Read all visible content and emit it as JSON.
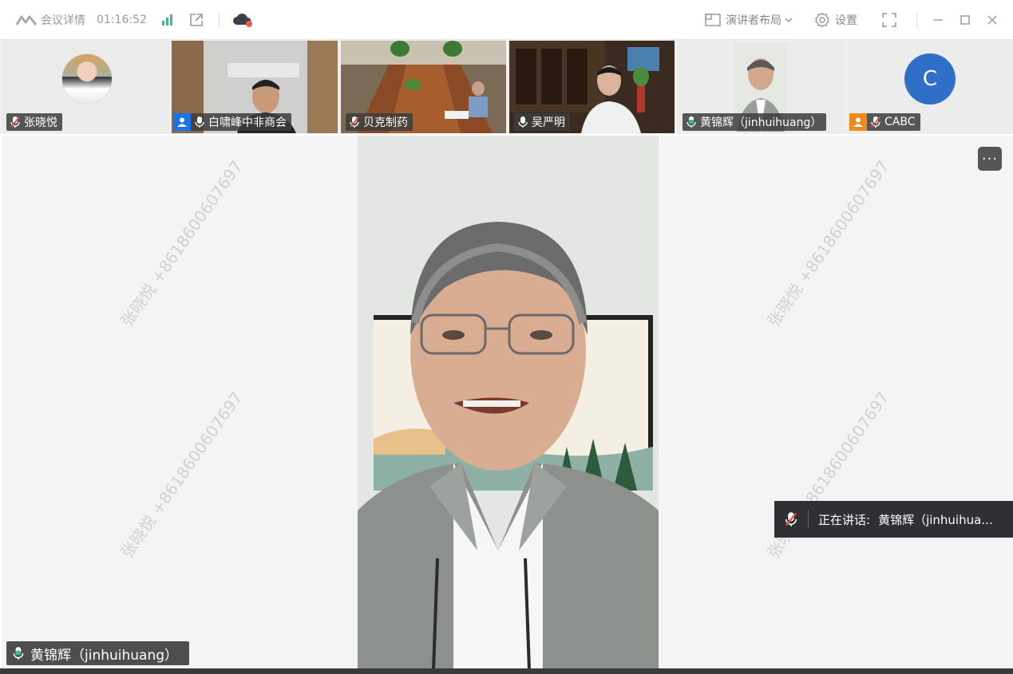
{
  "titlebar": {
    "meeting_details_label": "会议详情",
    "timer": "01:16:52",
    "layout_label": "演讲者布局",
    "settings_label": "设置"
  },
  "thumbnails": [
    {
      "name": "张晓悦",
      "mic": "muted",
      "badge": null,
      "kind": "avatar-photo"
    },
    {
      "name": "白啸峰中非商会",
      "mic": "on",
      "badge": "blue",
      "kind": "video"
    },
    {
      "name": "贝克制药",
      "mic": "muted",
      "badge": null,
      "kind": "video"
    },
    {
      "name": "吴严明",
      "mic": "on",
      "badge": null,
      "kind": "video"
    },
    {
      "name": "黄锦辉（jinhuihuang）",
      "mic": "speaking",
      "badge": null,
      "kind": "video",
      "active": true
    },
    {
      "name": "CABC",
      "mic": "muted",
      "badge": "orange",
      "kind": "avatar-letter",
      "letter": "C"
    }
  ],
  "main": {
    "watermark_text": "张晓悦 +8618600607697",
    "speaking_prefix": "正在讲话:",
    "speaking_name": "黄锦辉（jinhuihua...",
    "presenter_name": "黄锦辉（jinhuihuang）",
    "more_label": "···"
  },
  "colors": {
    "active_border": "#2bc48a",
    "avatar_blue": "#2f6fc7",
    "badge_blue": "#1a73e8",
    "badge_orange": "#f08a1c",
    "muted_red": "#e34b3b",
    "speaking_green": "#2bc48a"
  }
}
